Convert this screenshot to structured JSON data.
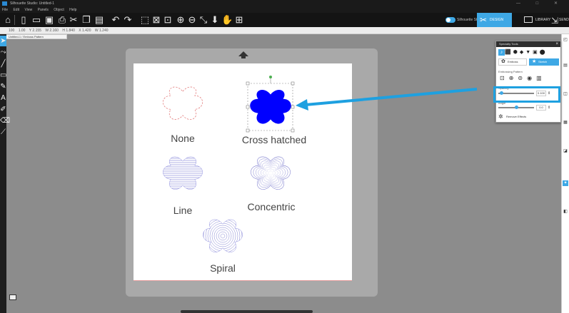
{
  "window": {
    "title": "Silhouette Studio: Untitled-1",
    "controls": "— □ ✕"
  },
  "menu": [
    "File",
    "Edit",
    "View",
    "Panels",
    "Object",
    "Help"
  ],
  "toolbar": {
    "toggle_label": "Silhouette Studio",
    "design_tab": "DESIGN",
    "library_tab": "LIBRARY",
    "send_tab": "SEND"
  },
  "options_bar": [
    "100",
    "1.00",
    "Y 2.155",
    "W 2.160",
    "H 1.840",
    "X 1.420",
    "W 1.240"
  ],
  "doc_tab": "Untitled-1 / Emboss Pattern",
  "canvas": {
    "labels": {
      "none": "None",
      "cross": "Cross hatched",
      "line": "Line",
      "concentric": "Concentric",
      "spiral": "Spiral"
    }
  },
  "panel": {
    "title": "Specialty Tools",
    "btn_emboss": "Emboss",
    "btn_sketch": "Sketch",
    "section_pattern": "Embossing Pattern",
    "spacing_label": "Spacing",
    "spacing_value": "0.100",
    "angle_label": "Angle",
    "angle_value": "0.0",
    "remove_effects": "Remove Effects"
  },
  "colors": {
    "accent": "#3ea8e5",
    "selected_fill": "#0000ff",
    "outline_none": "#e07070",
    "pattern_stroke": "#5555cc",
    "callout": "#1ea0e0"
  }
}
